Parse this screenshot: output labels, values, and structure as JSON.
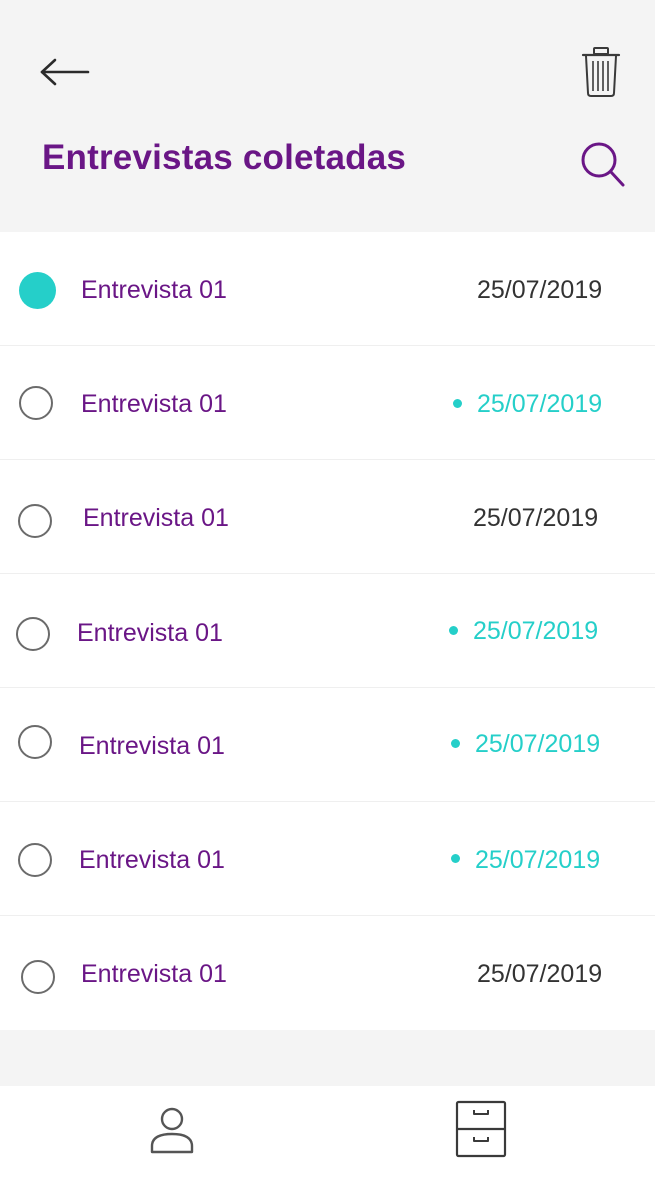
{
  "header": {
    "title": "Entrevistas coletadas",
    "back_icon": "arrow-left-icon",
    "trash_icon": "trash-icon",
    "search_icon": "search-icon"
  },
  "colors": {
    "brand_purple": "#6a1686",
    "accent_teal": "#25cfc9",
    "background": "#f4f4f4",
    "text_dark": "#333333"
  },
  "interviews": [
    {
      "title": "Entrevista 01",
      "date": "25/07/2019",
      "selected": true,
      "new": false
    },
    {
      "title": "Entrevista 01",
      "date": "25/07/2019",
      "selected": false,
      "new": true
    },
    {
      "title": "Entrevista 01",
      "date": "25/07/2019",
      "selected": false,
      "new": false
    },
    {
      "title": "Entrevista 01",
      "date": "25/07/2019",
      "selected": false,
      "new": true
    },
    {
      "title": "Entrevista 01",
      "date": "25/07/2019",
      "selected": false,
      "new": true
    },
    {
      "title": "Entrevista 01",
      "date": "25/07/2019",
      "selected": false,
      "new": true
    },
    {
      "title": "Entrevista 01",
      "date": "25/07/2019",
      "selected": false,
      "new": false
    }
  ],
  "bottom_nav": {
    "profile_icon": "user-icon",
    "archive_icon": "archive-drawer-icon"
  }
}
